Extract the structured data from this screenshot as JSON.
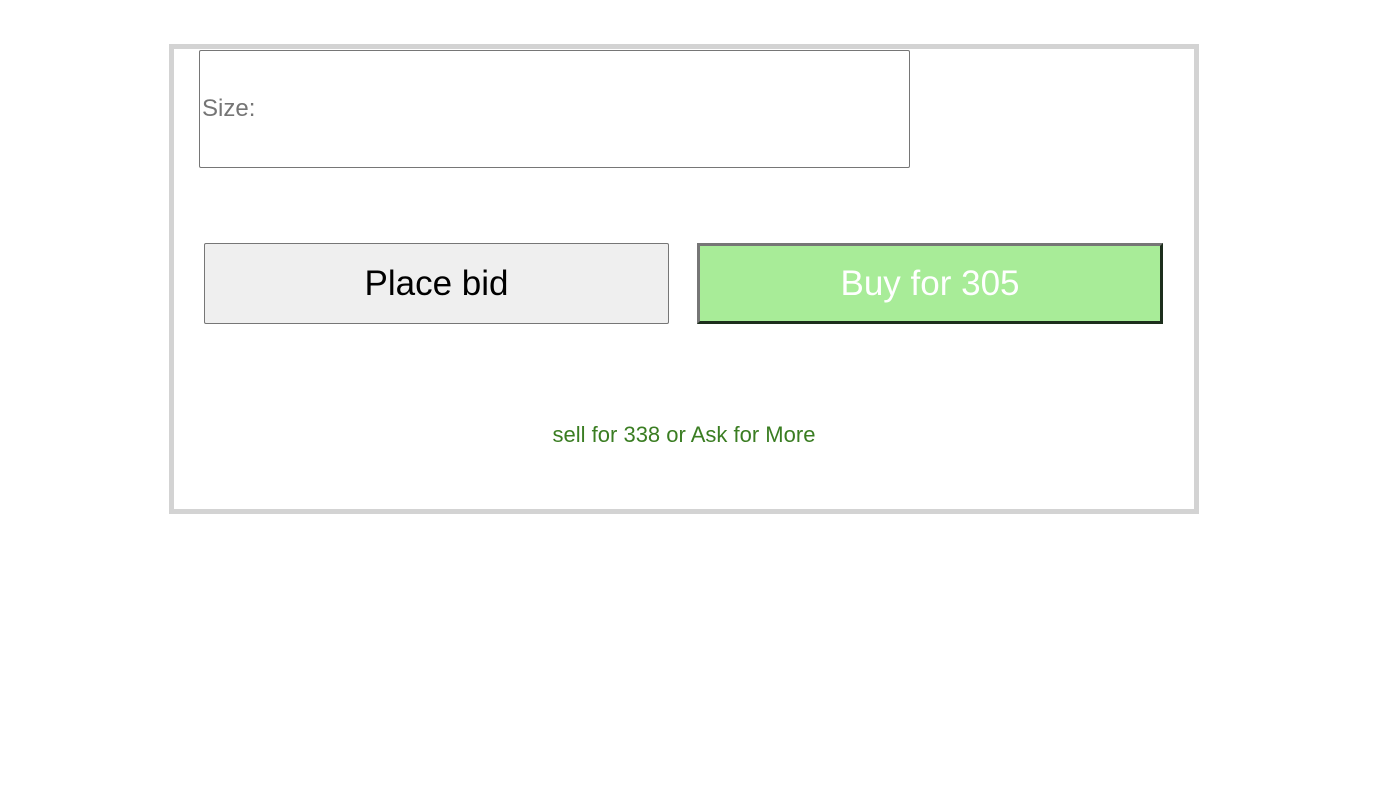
{
  "form": {
    "size_field": {
      "placeholder": "Size:",
      "value": ""
    },
    "bid_label": "Place bid",
    "buy_label": "Buy for 305",
    "sell_text": "sell for 338 or Ask for More"
  },
  "colors": {
    "panel_border": "#d3d3d3",
    "buy_background": "#a8ec98",
    "buy_text": "#ffffff",
    "sell_text": "#3a7d22",
    "bid_background": "#efefef"
  }
}
